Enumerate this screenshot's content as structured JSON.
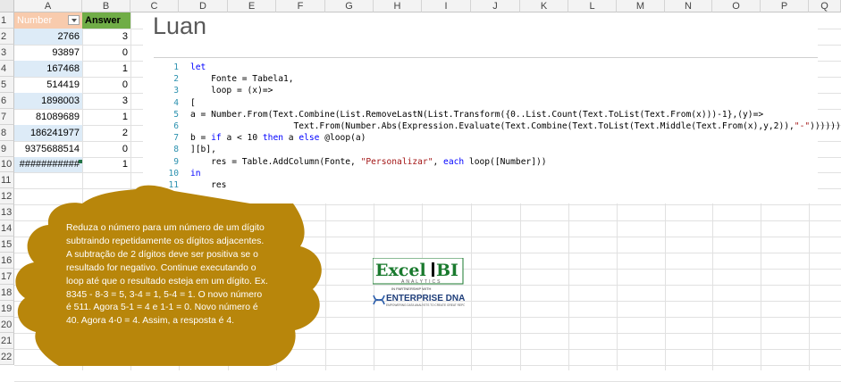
{
  "columns": [
    "A",
    "B",
    "C",
    "D",
    "E",
    "F",
    "G",
    "H",
    "I",
    "J",
    "K",
    "L",
    "M",
    "N",
    "O",
    "P",
    "Q"
  ],
  "rows": [
    "1",
    "2",
    "3",
    "4",
    "5",
    "6",
    "7",
    "8",
    "9",
    "10",
    "11",
    "12",
    "13",
    "14",
    "15",
    "16",
    "17",
    "18",
    "19",
    "20",
    "21",
    "22"
  ],
  "table": {
    "header_a": "Number",
    "header_b": "Answer",
    "rows": [
      {
        "a": "2766",
        "b": "3"
      },
      {
        "a": "93897",
        "b": "0"
      },
      {
        "a": "167468",
        "b": "1"
      },
      {
        "a": "514419",
        "b": "0"
      },
      {
        "a": "1898003",
        "b": "3"
      },
      {
        "a": "81089689",
        "b": "1"
      },
      {
        "a": "186241977",
        "b": "2"
      },
      {
        "a": "9375688514",
        "b": "0"
      },
      {
        "a": "###########",
        "b": "1"
      }
    ]
  },
  "solution": {
    "title": "Luan",
    "code_lines": [
      {
        "n": "1",
        "t": "let"
      },
      {
        "n": "2",
        "t": "    Fonte = Tabela1,"
      },
      {
        "n": "3",
        "t": "    loop = (x)=>"
      },
      {
        "n": "4",
        "t": "["
      },
      {
        "n": "5",
        "t": "a = Number.From(Text.Combine(List.RemoveLastN(List.Transform({0..List.Count(Text.ToList(Text.From(x)))-1},(y)=>"
      },
      {
        "n": "6",
        "t": "                    Text.From(Number.Abs(Expression.Evaluate(Text.Combine(Text.ToList(Text.Middle(Text.From(x),y,2)),\"-\"))))))),"
      },
      {
        "n": "7",
        "t": "b = if a < 10 then a else @loop(a)"
      },
      {
        "n": "8",
        "t": "][b],"
      },
      {
        "n": "9",
        "t": "    res = Table.AddColumn(Fonte, \"Personalizar\", each loop([Number]))"
      },
      {
        "n": "10",
        "t": "in"
      },
      {
        "n": "11",
        "t": "    res"
      }
    ]
  },
  "cloud_text": "Reduza o número para um número de um dígito subtraindo repetidamente os dígitos adjacentes. A subtração de 2 dígitos deve ser positiva se o resultado for negativo. Continue executando o loop até que o resultado esteja em um dígito. Ex. 8345 - 8-3 = 5, 3-4 = 1, 5-4 = 1. O novo número é 511. Agora 5-1 = 4 e 1-1 = 0. Novo número é 40. Agora 4-0 = 4. Assim, a resposta é 4.",
  "logos": {
    "excelbi": "Excel BI",
    "excelbi_sub": "ANALYTICS",
    "partnership": "IN PARTNERSHIP WITH",
    "enterprise": "ENTERPRISE DNA",
    "enterprise_sub": "EMPOWERING DATA ANALYSTS TO CREATE GREAT REPORTS"
  },
  "colors": {
    "cloud": "#b8860b",
    "header_a": "#f8cbad",
    "header_b": "#70ad47",
    "row_highlight": "#ddebf7"
  }
}
